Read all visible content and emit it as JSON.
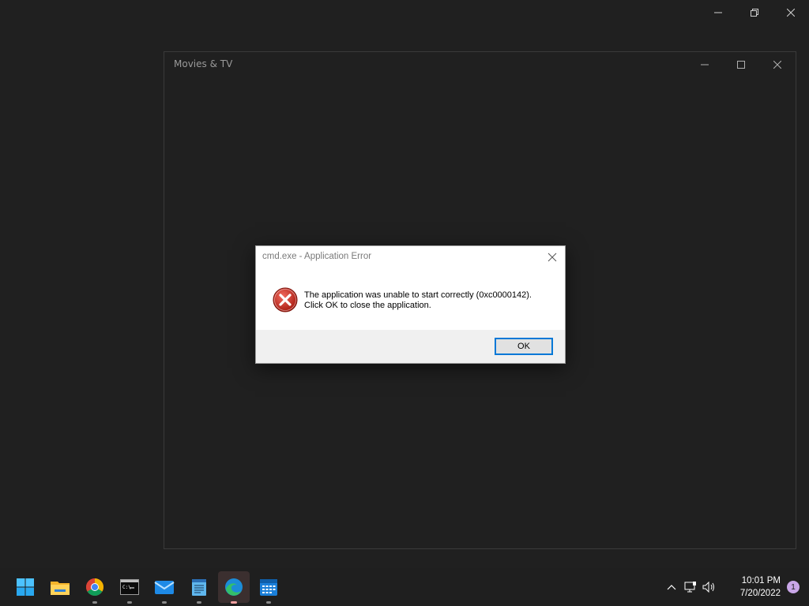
{
  "desktop": {
    "outer_controls": [
      "minimize-icon",
      "restore-icon",
      "close-icon"
    ]
  },
  "app_window": {
    "title": "Movies & TV",
    "controls": [
      "minimize-icon",
      "maximize-icon",
      "close-icon"
    ]
  },
  "dialog": {
    "title": "cmd.exe - Application Error",
    "icon": "error-icon",
    "message_line1": "The application was unable to start correctly (0xc0000142).",
    "message_line2": "Click OK to close the application.",
    "ok_label": "OK"
  },
  "taskbar": {
    "apps": [
      {
        "name": "start",
        "icon": "windows-start-icon"
      },
      {
        "name": "file-explorer",
        "icon": "folder-icon"
      },
      {
        "name": "chrome",
        "icon": "chrome-icon"
      },
      {
        "name": "terminal",
        "icon": "terminal-icon"
      },
      {
        "name": "mail",
        "icon": "mail-icon"
      },
      {
        "name": "notepad",
        "icon": "notepad-icon"
      },
      {
        "name": "edge",
        "icon": "edge-icon",
        "active": true
      },
      {
        "name": "calendar",
        "icon": "calendar-icon"
      }
    ],
    "tray": {
      "icons": [
        "chevron-up-icon",
        "network-icon",
        "volume-icon"
      ],
      "time": "10:01 PM",
      "date": "7/20/2022",
      "notification_count": "1"
    }
  },
  "colors": {
    "desktop_bg": "#202020",
    "accent": "#0078d7",
    "error_red": "#c42b1c"
  }
}
